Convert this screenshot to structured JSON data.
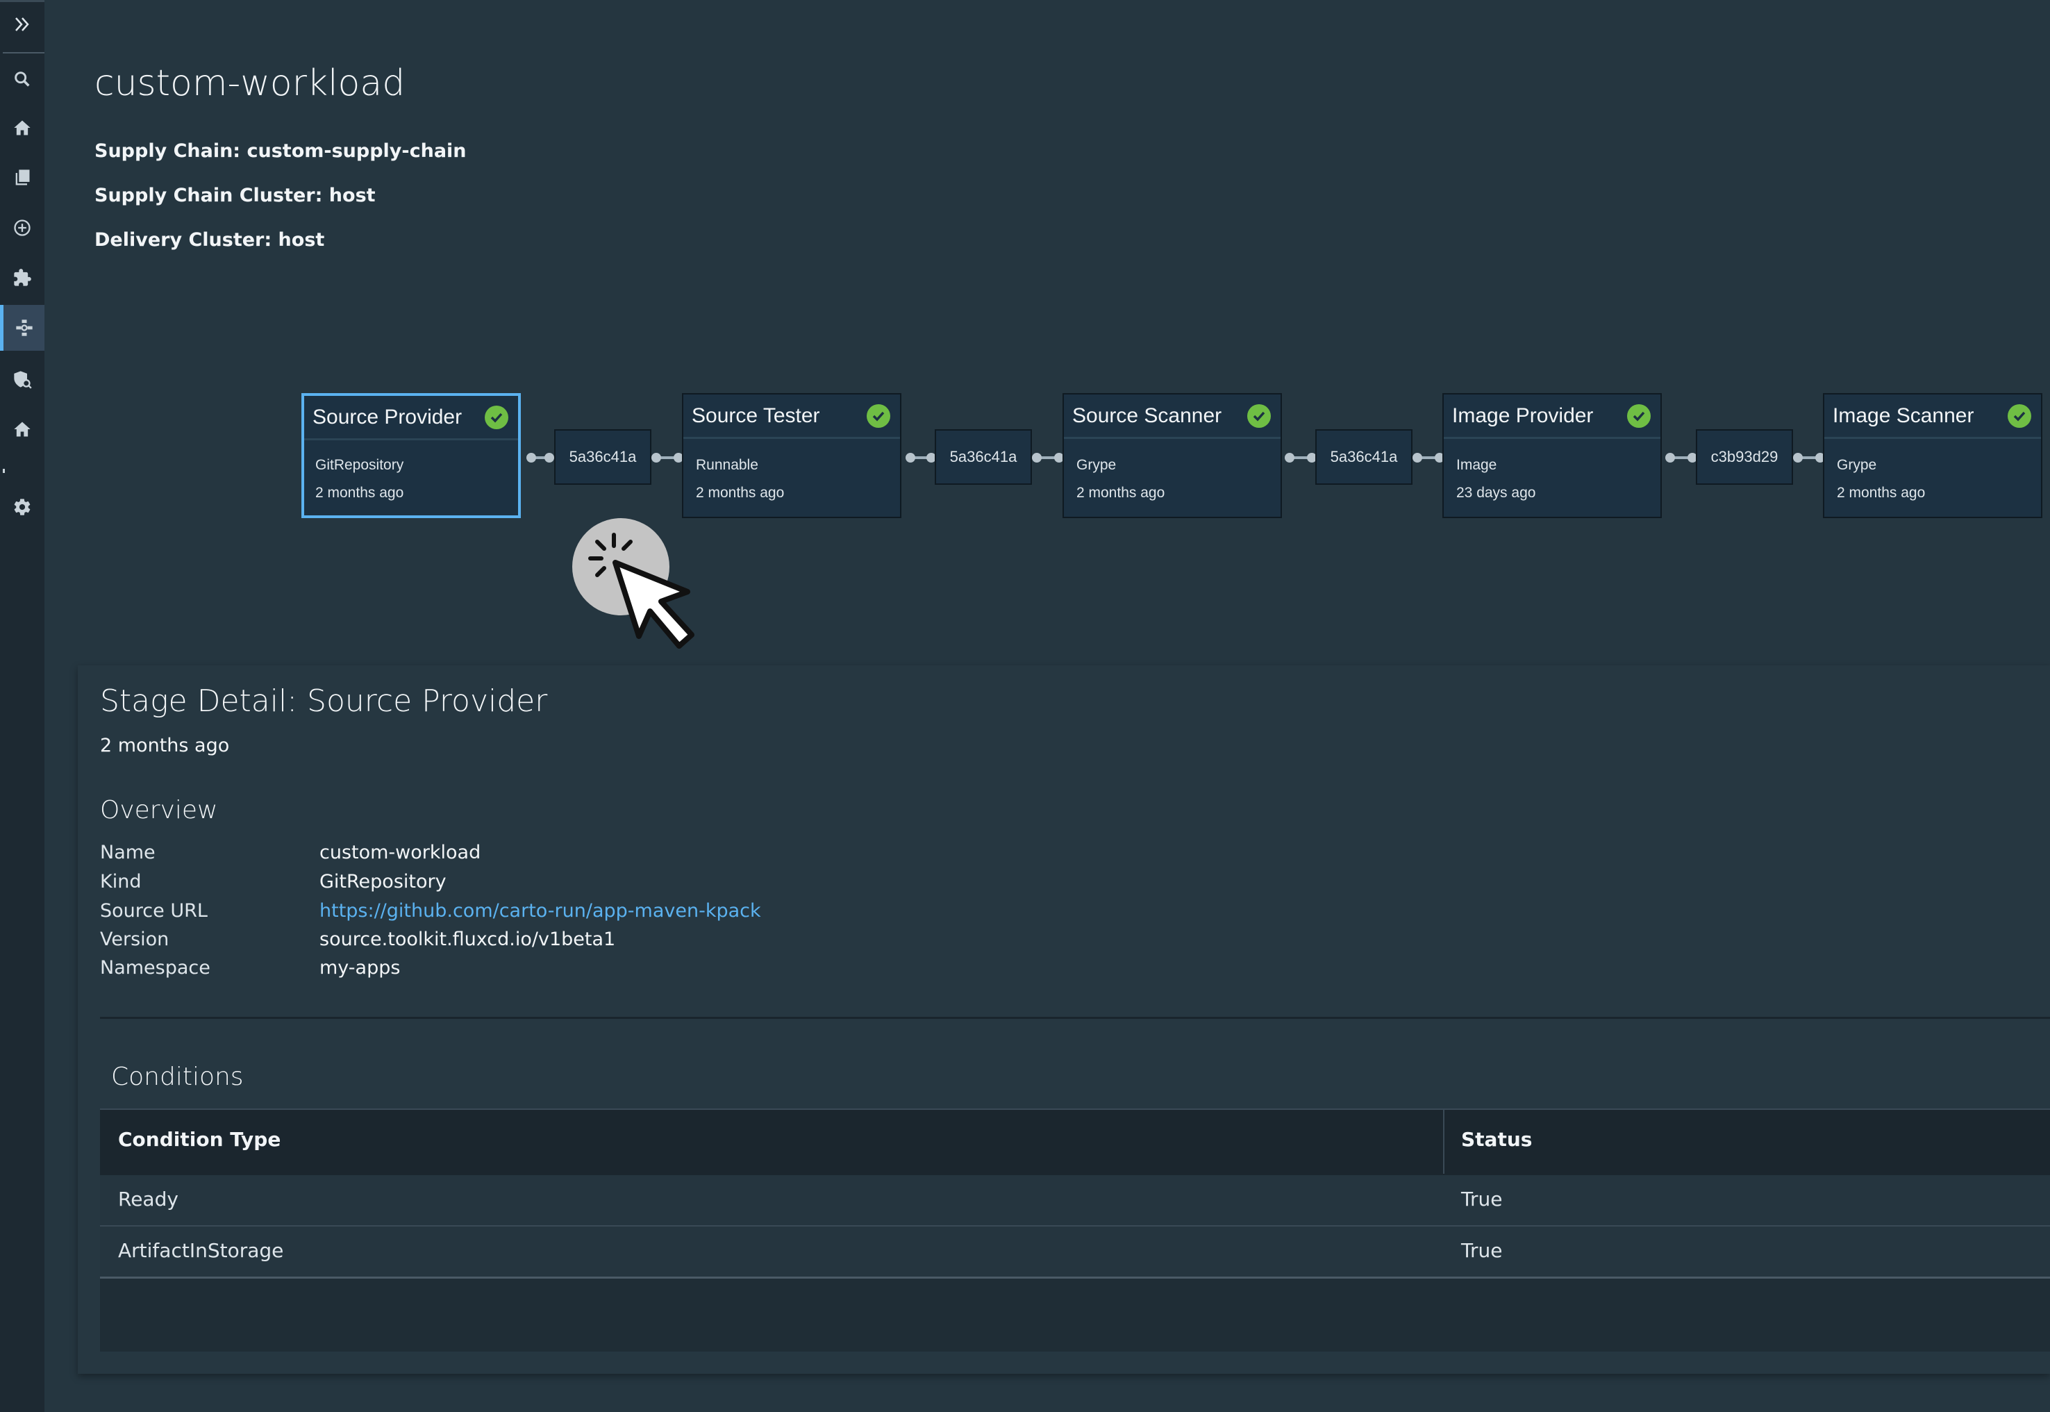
{
  "header": {
    "title": "custom-workload",
    "supply_chain": "Supply Chain: custom-supply-chain",
    "supply_chain_cluster": "Supply Chain Cluster: host",
    "delivery_cluster": "Delivery Cluster: host"
  },
  "sidebar": {
    "icons": [
      "chevron-double-right-icon",
      "search-icon",
      "home-icon",
      "catalog-icon",
      "create-icon",
      "plugin-icon",
      "supply-chain-icon",
      "security-icon",
      "home-icon",
      "settings-icon"
    ]
  },
  "pipeline": {
    "stages": [
      {
        "name": "Source Provider",
        "kind": "GitRepository",
        "time": "2 months ago"
      },
      {
        "name": "Source Tester",
        "kind": "Runnable",
        "time": "2 months ago"
      },
      {
        "name": "Source Scanner",
        "kind": "Grype",
        "time": "2 months ago"
      },
      {
        "name": "Image Provider",
        "kind": "Image",
        "time": "23 days ago"
      },
      {
        "name": "Image Scanner",
        "kind": "Grype",
        "time": "2 months ago"
      }
    ],
    "artifacts": [
      "5a36c41a",
      "5a36c41a",
      "5a36c41a",
      "c3b93d29"
    ]
  },
  "detail": {
    "title": "Stage Detail: Source Provider",
    "time": "2 months ago",
    "overview_title": "Overview",
    "fields": [
      {
        "label": "Name",
        "value": "custom-workload"
      },
      {
        "label": "Kind",
        "value": "GitRepository"
      },
      {
        "label": "Source URL",
        "value": "https://github.com/carto-run/app-maven-kpack"
      },
      {
        "label": "Version",
        "value": "source.toolkit.fluxcd.io/v1beta1"
      },
      {
        "label": "Namespace",
        "value": "my-apps"
      }
    ],
    "conditions": {
      "title": "Conditions",
      "columns": [
        "Condition Type",
        "Status"
      ],
      "rows": [
        [
          "Ready",
          "True"
        ],
        [
          "ArtifactInStorage",
          "True"
        ]
      ]
    }
  },
  "colors": {
    "background": "#253640",
    "accent": "#5bb2f0",
    "success": "#6fbe44"
  }
}
